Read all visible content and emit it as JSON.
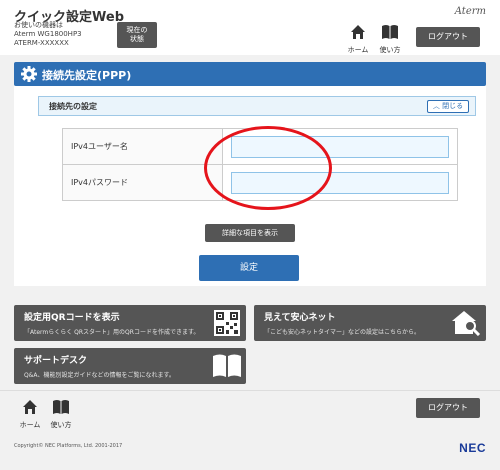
{
  "header": {
    "app_title": "クイック設定Web",
    "device_line1": "お使いの機器は",
    "device_line2": "Aterm WG1800HP3",
    "device_line3": "ATERM-XXXXXX",
    "status_line1": "現在の",
    "status_line2": "状態",
    "brand": "Aterm",
    "home_label": "ホーム",
    "usage_label": "使い方",
    "logout_label": "ログアウト"
  },
  "section": {
    "title": "接続先設定(PPP)",
    "subsection_title": "接続先の設定",
    "collapse_label": "閉じる"
  },
  "form": {
    "fields": [
      {
        "label": "IPv4ユーザー名",
        "value": ""
      },
      {
        "label": "IPv4パスワード",
        "value": ""
      }
    ],
    "detail_button": "詳細な項目を表示",
    "submit_button": "設定"
  },
  "tiles": [
    {
      "title": "設定用QRコードを表示",
      "desc": "「Atermらくらく QRスタート」用のQRコードを作成できます。",
      "icon": "qr-code-icon"
    },
    {
      "title": "見えて安心ネット",
      "desc": "「こども安心ネットタイマー」などの設定はこちらから。",
      "icon": "house-search-icon"
    },
    {
      "title": "サポートデスク",
      "desc": "Q&A、機能別設定ガイドなどの情報をご覧になれます。",
      "icon": "book-icon"
    }
  ],
  "footer": {
    "home_label": "ホーム",
    "usage_label": "使い方",
    "logout_label": "ログアウト",
    "copyright": "Copyright© NEC Platforms, Ltd. 2001-2017",
    "brand": "NEC"
  },
  "colors": {
    "primary": "#2e6fb4",
    "dark_button": "#555555",
    "annotation": "#e5141b"
  }
}
